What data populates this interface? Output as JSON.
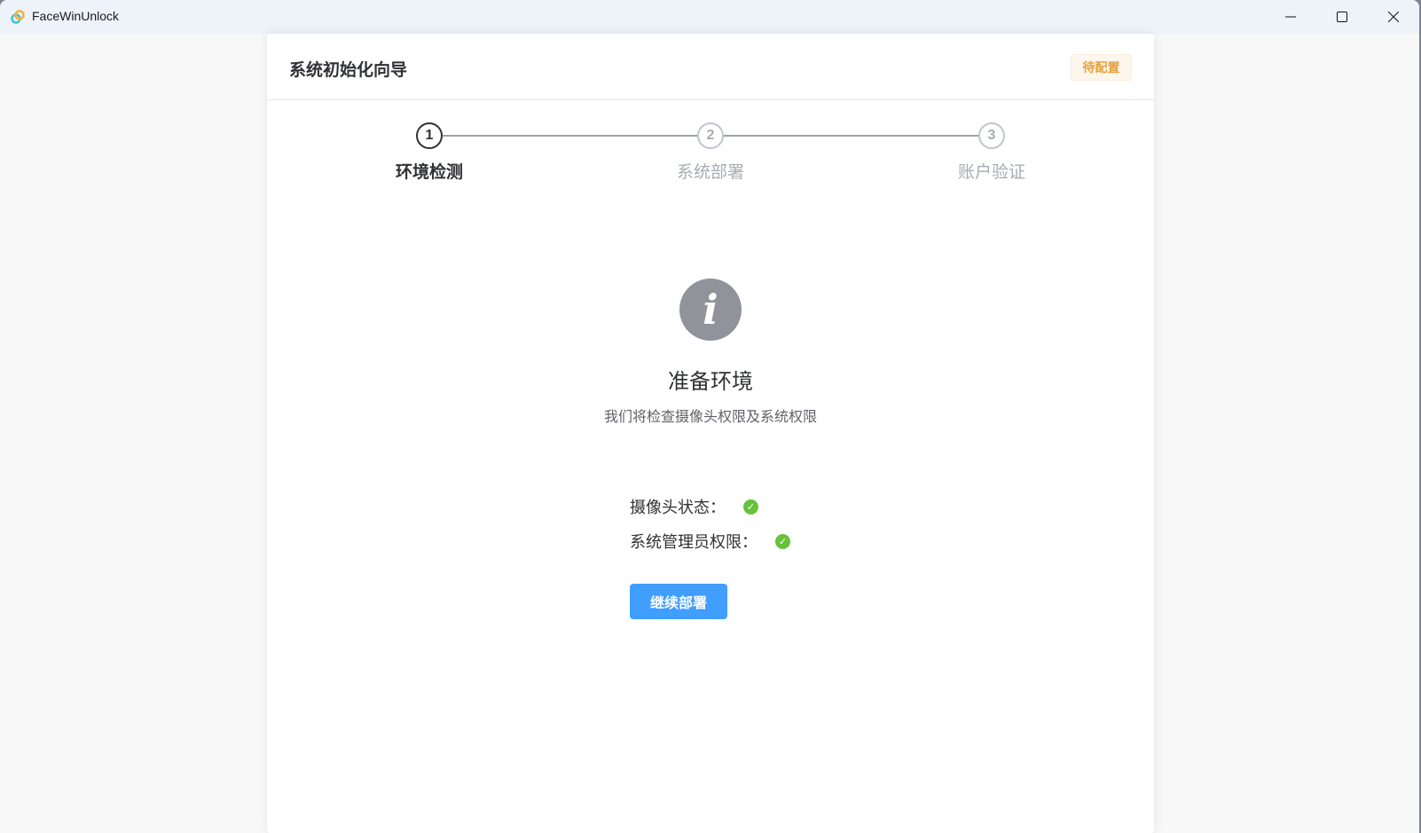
{
  "window": {
    "title": "FaceWinUnlock"
  },
  "card": {
    "title": "系统初始化向导",
    "badge": "待配置"
  },
  "steps": [
    {
      "num": "1",
      "label": "环境检测"
    },
    {
      "num": "2",
      "label": "系统部署"
    },
    {
      "num": "3",
      "label": "账户验证"
    }
  ],
  "content": {
    "title": "准备环境",
    "subtitle": "我们将检查摄像头权限及系统权限",
    "checks": [
      {
        "label": "摄像头状态：",
        "status": "ok"
      },
      {
        "label": "系统管理员权限：",
        "status": "ok"
      }
    ],
    "button": "继续部署"
  },
  "colors": {
    "accent": "#409eff",
    "success": "#67c23a",
    "warning": "#e6a23c"
  }
}
